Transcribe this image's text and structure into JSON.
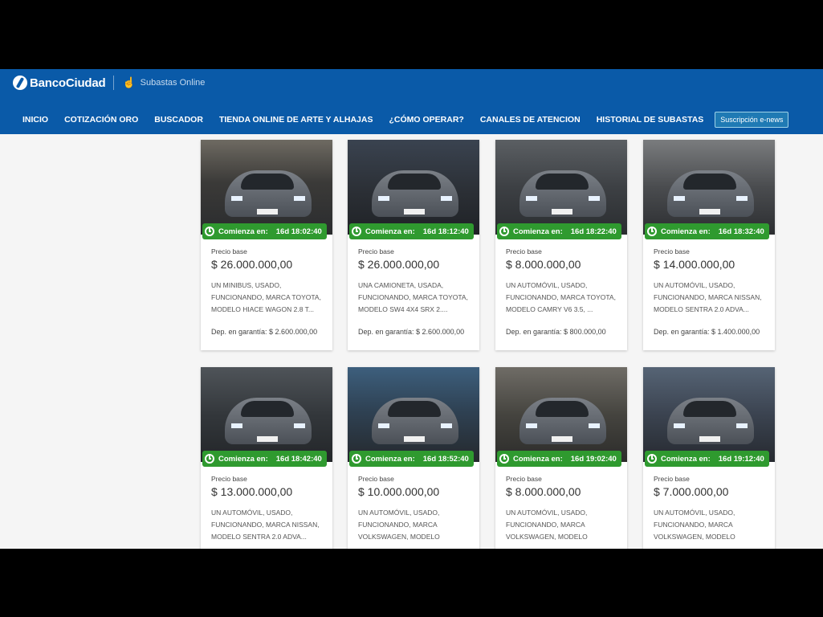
{
  "header": {
    "brand": "BancoCiudad",
    "subtitle": "Subastas Online",
    "nav": [
      "INICIO",
      "COTIZACIÓN ORO",
      "BUSCADOR",
      "TIENDA ONLINE DE ARTE Y ALHAJAS",
      "¿CÓMO OPERAR?",
      "CANALES DE ATENCION",
      "HISTORIAL DE SUBASTAS"
    ],
    "subscribe_button": "Suscripción e-news"
  },
  "colors": {
    "header_bg": "#0a5aa8",
    "badge_bg": "#2f9a2f",
    "page_bg": "#f5f5f5"
  },
  "cards": [
    {
      "starts_label": "Comienza en:",
      "starts_in": "16d 18:02:40",
      "price_label": "Precio base",
      "price": "$ 26.000.000,00",
      "description": "UN MINIBUS, USADO, FUNCIONANDO, MARCA TOYOTA, MODELO HIACE WAGON 2.8 T...",
      "deposit": "Dep. en garantía: $ 2.600.000,00"
    },
    {
      "starts_label": "Comienza en:",
      "starts_in": "16d 18:12:40",
      "price_label": "Precio base",
      "price": "$ 26.000.000,00",
      "description": "UNA CAMIONETA, USADA, FUNCIONANDO, MARCA TOYOTA, MODELO SW4 4X4 SRX 2....",
      "deposit": "Dep. en garantía: $ 2.600.000,00"
    },
    {
      "starts_label": "Comienza en:",
      "starts_in": "16d 18:22:40",
      "price_label": "Precio base",
      "price": "$ 8.000.000,00",
      "description": "UN AUTOMÓVIL, USADO, FUNCIONANDO, MARCA TOYOTA, MODELO CAMRY V6 3.5, ...",
      "deposit": "Dep. en garantía: $ 800.000,00"
    },
    {
      "starts_label": "Comienza en:",
      "starts_in": "16d 18:32:40",
      "price_label": "Precio base",
      "price": "$ 14.000.000,00",
      "description": "UN AUTOMÓVIL, USADO, FUNCIONANDO, MARCA NISSAN, MODELO SENTRA 2.0 ADVA...",
      "deposit": "Dep. en garantía: $ 1.400.000,00"
    },
    {
      "starts_label": "Comienza en:",
      "starts_in": "16d 18:42:40",
      "price_label": "Precio base",
      "price": "$ 13.000.000,00",
      "description": "UN AUTOMÓVIL, USADO, FUNCIONANDO, MARCA NISSAN, MODELO SENTRA 2.0 ADVA...",
      "deposit": ""
    },
    {
      "starts_label": "Comienza en:",
      "starts_in": "16d 18:52:40",
      "price_label": "Precio base",
      "price": "$ 10.000.000,00",
      "description": "UN AUTOMÓVIL, USADO, FUNCIONANDO, MARCA VOLKSWAGEN, MODELO VOLKSWAGEN",
      "deposit": ""
    },
    {
      "starts_label": "Comienza en:",
      "starts_in": "16d 19:02:40",
      "price_label": "Precio base",
      "price": "$ 8.000.000,00",
      "description": "UN AUTOMÓVIL, USADO, FUNCIONANDO, MARCA VOLKSWAGEN, MODELO VOLKSWAGEN",
      "deposit": ""
    },
    {
      "starts_label": "Comienza en:",
      "starts_in": "16d 19:12:40",
      "price_label": "Precio base",
      "price": "$ 7.000.000,00",
      "description": "UN AUTOMÓVIL, USADO, FUNCIONANDO, MARCA VOLKSWAGEN, MODELO VOLKSWAGEN",
      "deposit": ""
    }
  ]
}
